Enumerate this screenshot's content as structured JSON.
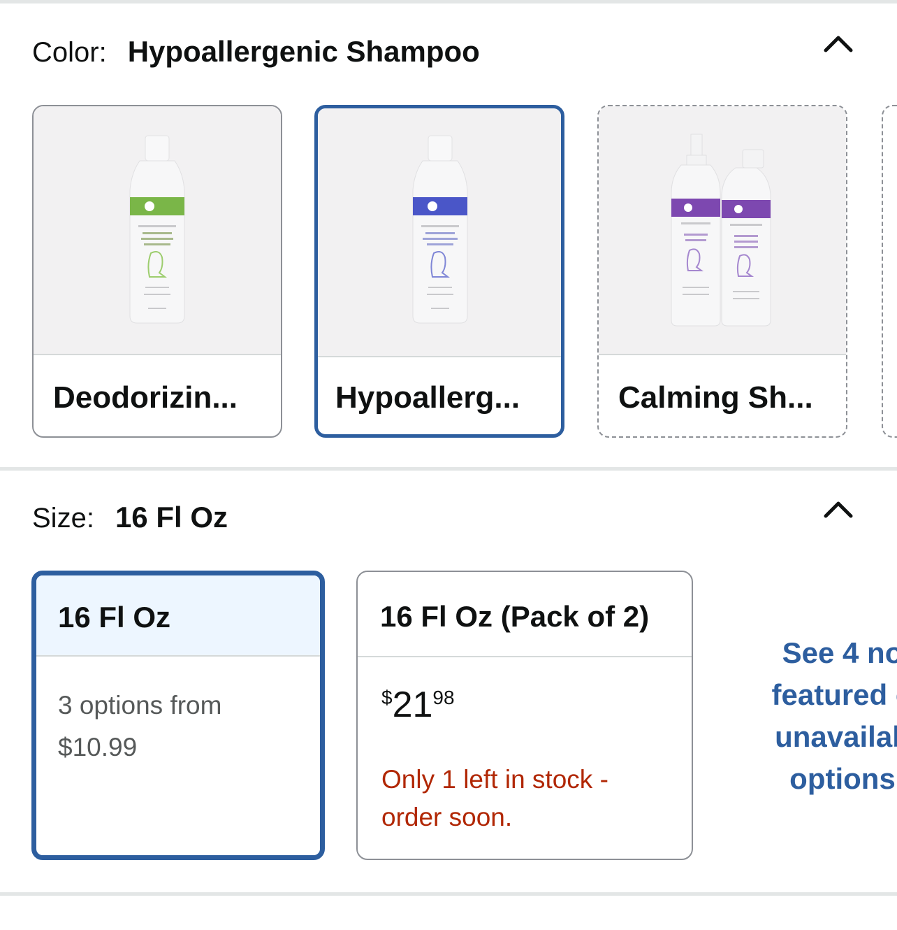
{
  "color_section": {
    "label": "Color:",
    "selected_value": "Hypoallergenic Shampoo",
    "collapse_icon": "chevron-up-icon",
    "options": [
      {
        "name": "Deodorizin...",
        "state": "normal",
        "accent": "#7ab648"
      },
      {
        "name": "Hypoallerg...",
        "state": "selected",
        "accent": "#4a56c8"
      },
      {
        "name": "Calming Sh...",
        "state": "unavailable",
        "accent": "#7d48b0"
      }
    ]
  },
  "size_section": {
    "label": "Size:",
    "selected_value": "16 Fl Oz",
    "collapse_icon": "chevron-up-icon",
    "options": [
      {
        "title": "16 Fl Oz",
        "state": "selected",
        "line1": "3 options from",
        "line2": "$10.99"
      },
      {
        "title": "16 Fl Oz (Pack of 2)",
        "state": "normal",
        "price_symbol": "$",
        "price_whole": "21",
        "price_fraction": "98",
        "stock_line1": "Only 1 left in stock -",
        "stock_line2": "order soon."
      }
    ],
    "see_more": [
      "See 4 no",
      "featured o",
      "unavailab",
      "options"
    ]
  },
  "colors": {
    "selected_border": "#2d5e9f",
    "link": "#2d5e9f",
    "stock_warning": "#b12704",
    "selected_bg": "#edf6ff"
  }
}
